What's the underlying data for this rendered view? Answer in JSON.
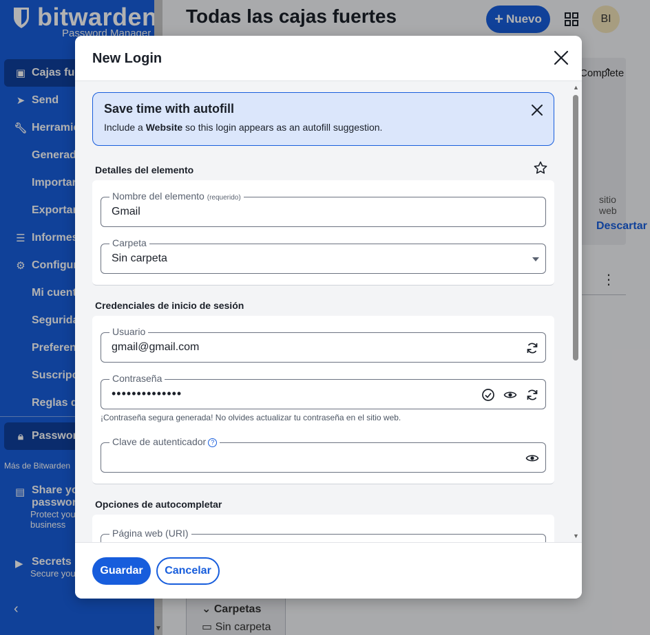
{
  "brand": {
    "name": "bitwarden",
    "subtitle": "Password Manager"
  },
  "sidebar": {
    "items": [
      {
        "label": "Cajas fuertes",
        "icon": "vault-icon"
      },
      {
        "label": "Send",
        "icon": "send-icon"
      },
      {
        "label": "Herramientas",
        "icon": "wrench-icon"
      },
      {
        "label": "Generador"
      },
      {
        "label": "Importar"
      },
      {
        "label": "Exportar"
      },
      {
        "label": "Informes",
        "icon": "sliders-icon"
      },
      {
        "label": "Configuración",
        "icon": "gear-icon"
      },
      {
        "label": "Mi cuenta"
      },
      {
        "label": "Seguridad"
      },
      {
        "label": "Preferencias"
      },
      {
        "label": "Suscripción"
      },
      {
        "label": "Reglas de dominio"
      }
    ],
    "product_switch": "Password Manager",
    "more_label": "Más de Bitwarden",
    "promos": [
      {
        "title_line1": "Share your",
        "title_line2": "passwords",
        "desc_line1": "Protect your",
        "desc_line2": "business",
        "icon": "building-icon"
      },
      {
        "title_line1": "Secrets Manager",
        "desc_line1": "Secure your secrets",
        "icon": "terminal-icon"
      }
    ]
  },
  "header": {
    "title": "Todas las cajas fuertes",
    "new_button": "Nuevo",
    "avatar_initials": "BI"
  },
  "background": {
    "panel_text_1": "Complete",
    "panel_text_2": "sitio web",
    "panel_link": "Descartar",
    "folders_label": "Carpetas",
    "folder_item": "Sin carpeta"
  },
  "dialog": {
    "title": "New Login",
    "callout": {
      "title": "Save time with autofill",
      "desc_prefix": "Include a ",
      "desc_bold": "Website",
      "desc_suffix": " so this login appears as an autofill suggestion."
    },
    "section_details": "Detalles del elemento",
    "name_field": {
      "label": "Nombre del elemento",
      "required": "(requerido)",
      "value": "Gmail"
    },
    "folder_field": {
      "label": "Carpeta",
      "value": "Sin carpeta"
    },
    "section_credentials": "Credenciales de inicio de sesión",
    "username_field": {
      "label": "Usuario",
      "value": "gmail@gmail.com"
    },
    "password_field": {
      "label": "Contraseña",
      "value": "••••••••••••••",
      "helper": "¡Contraseña segura generada! No olvides actualizar tu contraseña en el sitio web."
    },
    "totp_field": {
      "label": "Clave de autenticador",
      "value": ""
    },
    "section_autofill": "Opciones de autocompletar",
    "uri_field": {
      "label": "Página web (URI)",
      "value": ""
    },
    "save_button": "Guardar",
    "cancel_button": "Cancelar"
  }
}
